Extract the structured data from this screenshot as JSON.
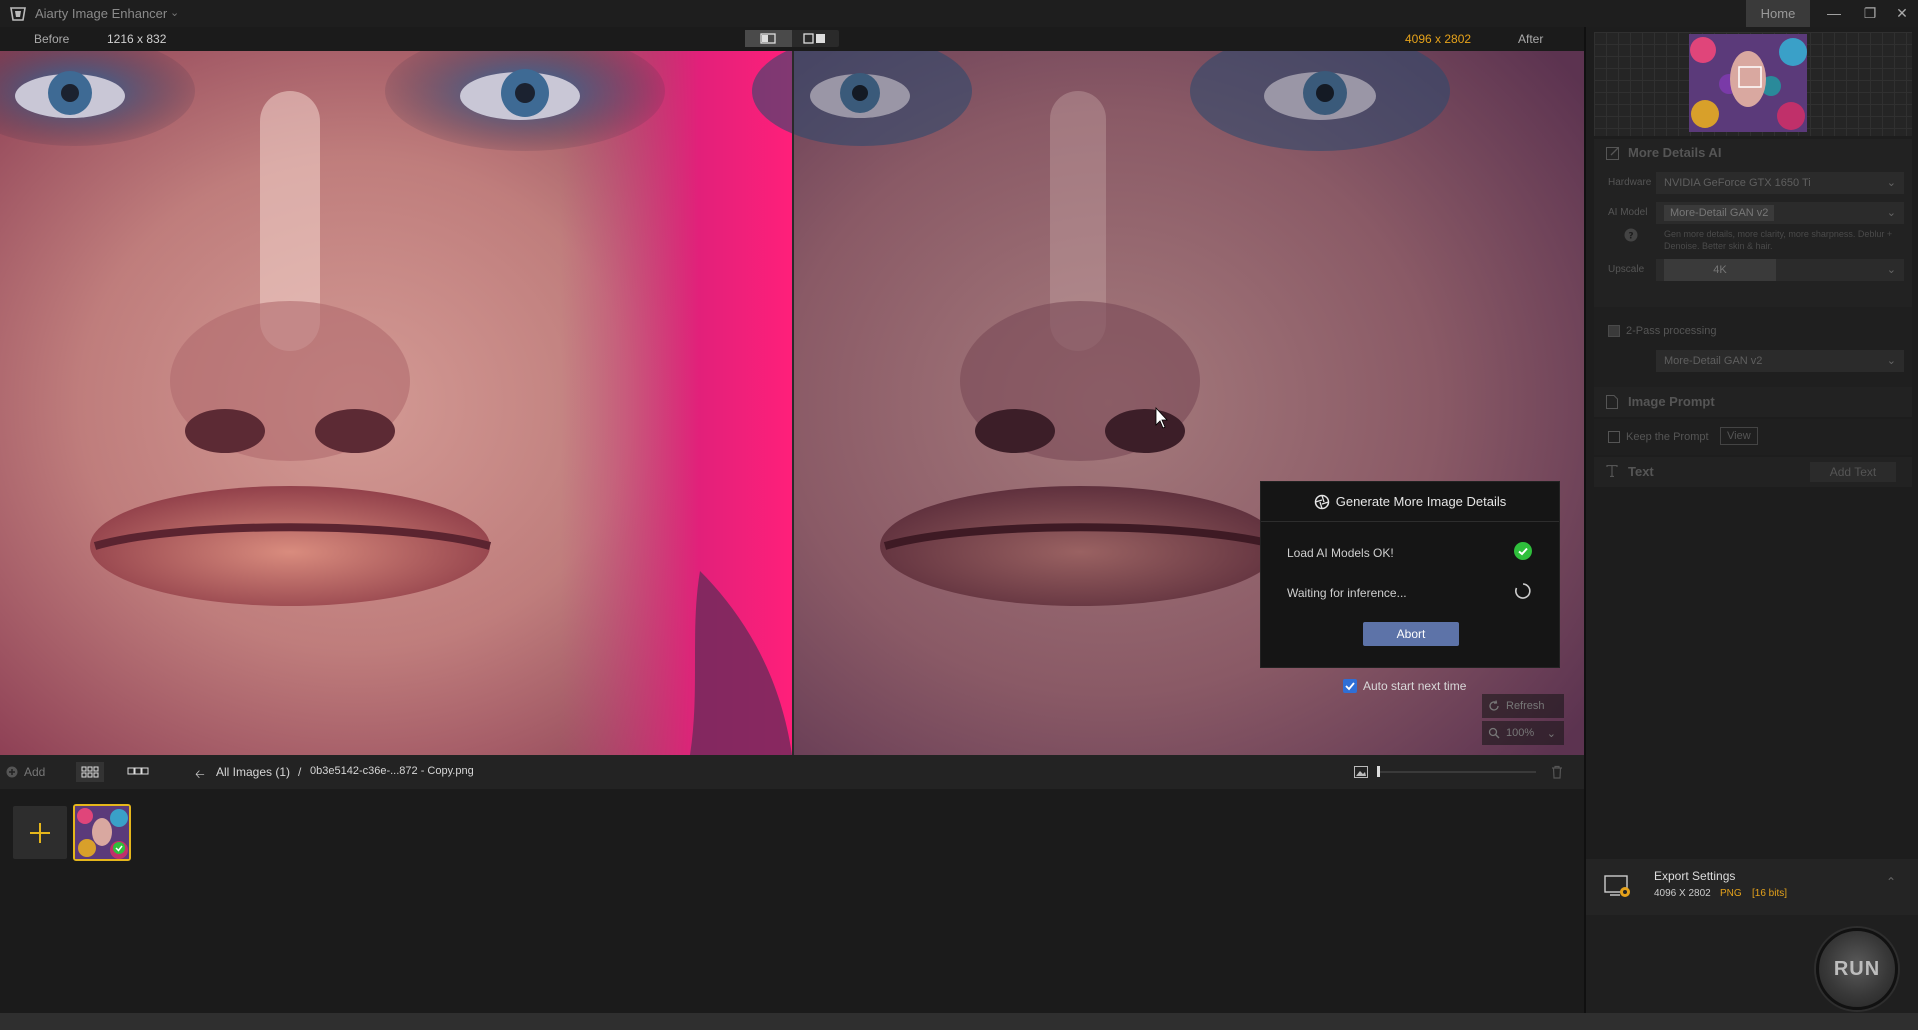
{
  "app": {
    "title": "Aiarty Image Enhancer",
    "home_label": "Home"
  },
  "compare": {
    "before_label": "Before",
    "before_size": "1216 x 832",
    "after_size": "4096 x 2802",
    "after_label": "After"
  },
  "dialog": {
    "title": "Generate More Image Details",
    "step1": "Load AI Models OK!",
    "step2": "Waiting for inference...",
    "abort_label": "Abort",
    "auto_start_label": "Auto start next time",
    "auto_start_checked": true
  },
  "viewer_tools": {
    "refresh_label": "Refresh",
    "zoom_label": "100%"
  },
  "bottombar": {
    "add_label": "Add",
    "breadcrumb_root": "All Images (1)",
    "breadcrumb_sep": "/",
    "file_name": "0b3e5142-c36e-...872 - Copy.png"
  },
  "panel": {
    "more_details_title": "More Details AI",
    "hardware_label": "Hardware",
    "hardware_value": "NVIDIA GeForce GTX 1650 Ti",
    "ai_model_label": "AI Model",
    "ai_model_value": "More-Detail GAN v2",
    "ai_model_desc": "Gen more details, more clarity, more sharpness. Deblur + Denoise. Better skin & hair.",
    "upscale_label": "Upscale",
    "upscale_value": "4K",
    "two_pass_label": "2-Pass processing",
    "two_pass_model": "More-Detail GAN v2",
    "image_prompt_title": "Image Prompt",
    "keep_prompt_label": "Keep the Prompt",
    "view_label": "View",
    "text_title": "Text",
    "add_text_label": "Add Text"
  },
  "export": {
    "title": "Export Settings",
    "dimensions": "4096 X 2802",
    "format": "PNG",
    "bits": "[16 bits]"
  },
  "run_label": "RUN",
  "colors": {
    "accent_orange": "#e5a21b",
    "abort_blue": "#5d73a8",
    "ok_green": "#2fbf3c",
    "checkbox_blue": "#2f6fd6"
  }
}
